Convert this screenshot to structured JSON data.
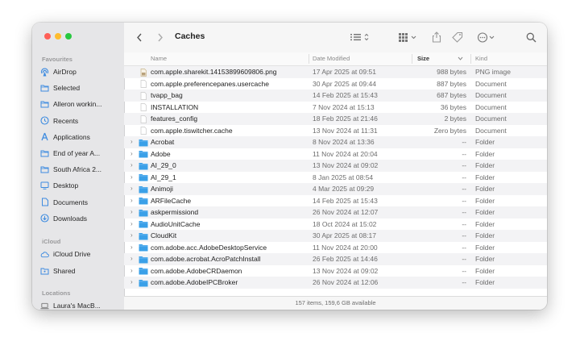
{
  "window": {
    "title": "Caches"
  },
  "sidebar": {
    "favourites_heading": "Favourites",
    "favourites": [
      {
        "label": "AirDrop",
        "icon": "airdrop-icon"
      },
      {
        "label": "Selected",
        "icon": "folder-icon"
      },
      {
        "label": "Alleron workin...",
        "icon": "folder-icon"
      },
      {
        "label": "Recents",
        "icon": "clock-icon"
      },
      {
        "label": "Applications",
        "icon": "applications-icon"
      },
      {
        "label": "End of year A...",
        "icon": "folder-icon"
      },
      {
        "label": "South Africa 2...",
        "icon": "folder-icon"
      },
      {
        "label": "Desktop",
        "icon": "desktop-icon"
      },
      {
        "label": "Documents",
        "icon": "document-icon"
      },
      {
        "label": "Downloads",
        "icon": "download-icon"
      }
    ],
    "icloud_heading": "iCloud",
    "icloud": [
      {
        "label": "iCloud Drive",
        "icon": "cloud-icon"
      },
      {
        "label": "Shared",
        "icon": "shared-folder-icon"
      }
    ],
    "locations_heading": "Locations",
    "locations": [
      {
        "label": "Laura's MacB...",
        "icon": "laptop-icon"
      }
    ]
  },
  "columns": {
    "name": "Name",
    "date": "Date Modified",
    "size": "Size",
    "kind": "Kind"
  },
  "files": [
    {
      "name": "com.apple.sharekit.14153899609806.png",
      "date": "17 Apr 2025 at 09:51",
      "size": "988 bytes",
      "kind": "PNG image",
      "type": "image"
    },
    {
      "name": "com.apple.preferencepanes.usercache",
      "date": "30 Apr 2025 at 09:44",
      "size": "887 bytes",
      "kind": "Document",
      "type": "doc"
    },
    {
      "name": "tvapp_bag",
      "date": "14 Feb 2025 at 15:43",
      "size": "687 bytes",
      "kind": "Document",
      "type": "doc"
    },
    {
      "name": "INSTALLATION",
      "date": "7 Nov 2024 at 15:13",
      "size": "36 bytes",
      "kind": "Document",
      "type": "doc"
    },
    {
      "name": "features_config",
      "date": "18 Feb 2025 at 21:46",
      "size": "2 bytes",
      "kind": "Document",
      "type": "doc"
    },
    {
      "name": "com.apple.tiswitcher.cache",
      "date": "13 Nov 2024 at 11:31",
      "size": "Zero bytes",
      "kind": "Document",
      "type": "doc"
    },
    {
      "name": "Acrobat",
      "date": "8 Nov 2024 at 13:36",
      "size": "--",
      "kind": "Folder",
      "type": "folder"
    },
    {
      "name": "Adobe",
      "date": "11 Nov 2024 at 20:04",
      "size": "--",
      "kind": "Folder",
      "type": "folder"
    },
    {
      "name": "AI_29_0",
      "date": "13 Nov 2024 at 09:02",
      "size": "--",
      "kind": "Folder",
      "type": "folder"
    },
    {
      "name": "AI_29_1",
      "date": "8 Jan 2025 at 08:54",
      "size": "--",
      "kind": "Folder",
      "type": "folder"
    },
    {
      "name": "Animoji",
      "date": "4 Mar 2025 at 09:29",
      "size": "--",
      "kind": "Folder",
      "type": "folder"
    },
    {
      "name": "ARFileCache",
      "date": "14 Feb 2025 at 15:43",
      "size": "--",
      "kind": "Folder",
      "type": "folder"
    },
    {
      "name": "askpermissiond",
      "date": "26 Nov 2024 at 12:07",
      "size": "--",
      "kind": "Folder",
      "type": "folder"
    },
    {
      "name": "AudioUnitCache",
      "date": "18 Oct 2024 at 15:02",
      "size": "--",
      "kind": "Folder",
      "type": "folder"
    },
    {
      "name": "CloudKit",
      "date": "30 Apr 2025 at 08:17",
      "size": "--",
      "kind": "Folder",
      "type": "folder"
    },
    {
      "name": "com.adobe.acc.AdobeDesktopService",
      "date": "11 Nov 2024 at 20:00",
      "size": "--",
      "kind": "Folder",
      "type": "folder"
    },
    {
      "name": "com.adobe.acrobat.AcroPatchInstall",
      "date": "26 Feb 2025 at 14:46",
      "size": "--",
      "kind": "Folder",
      "type": "folder"
    },
    {
      "name": "com.adobe.AdobeCRDaemon",
      "date": "13 Nov 2024 at 09:02",
      "size": "--",
      "kind": "Folder",
      "type": "folder"
    },
    {
      "name": "com.adobe.AdobeIPCBroker",
      "date": "26 Nov 2024 at 12:06",
      "size": "--",
      "kind": "Folder",
      "type": "folder"
    }
  ],
  "status": "157 items, 159,6 GB available",
  "colors": {
    "folder": "#3aa0e8",
    "sidebar_icon": "#3d8be0",
    "sidebar_bg": "#e6e6e8"
  }
}
